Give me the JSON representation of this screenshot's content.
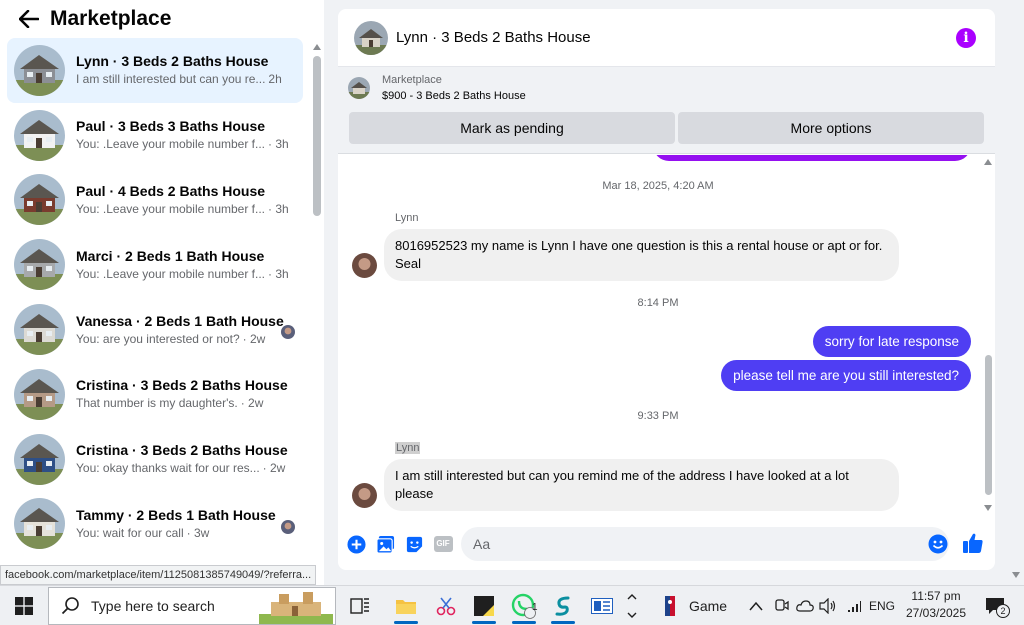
{
  "header": {
    "title": "Marketplace"
  },
  "conversations": [
    {
      "title": "Lynn · 3 Beds 2 Baths House",
      "snippet": "I am still interested but can you re...",
      "time": "2h",
      "active": true,
      "read_avatar": false,
      "house_color": "#8c8f95"
    },
    {
      "title": "Paul · 3 Beds 3 Baths House",
      "snippet": "You: .Leave your mobile number f...",
      "time": "· 3h",
      "active": false,
      "read_avatar": false,
      "house_color": "#f2f2f2"
    },
    {
      "title": "Paul · 4 Beds 2 Baths House",
      "snippet": "You: .Leave your mobile number f...",
      "time": "· 3h",
      "active": false,
      "read_avatar": false,
      "house_color": "#7a3b2e"
    },
    {
      "title": "Marci · 2 Beds 1 Bath House",
      "snippet": "You: .Leave your mobile number f...",
      "time": "· 3h",
      "active": false,
      "read_avatar": false,
      "house_color": "#a7a9ab"
    },
    {
      "title": "Vanessa · 2 Beds 1 Bath House",
      "snippet": "You: are you interested or not?",
      "time": "· 2w",
      "active": false,
      "read_avatar": true,
      "house_color": "#dcdad4"
    },
    {
      "title": "Cristina · 3 Beds 2 Baths House",
      "snippet": "That number is my daughter's.",
      "time": "· 2w",
      "active": false,
      "read_avatar": false,
      "house_color": "#b59a86"
    },
    {
      "title": "Cristina · 3 Beds 2 Baths House",
      "snippet": "You: okay thanks wait for our res...",
      "time": "· 2w",
      "active": false,
      "read_avatar": false,
      "house_color": "#2e4f86"
    },
    {
      "title": "Tammy · 2 Beds 1 Bath House",
      "snippet": "You: wait for our call",
      "time": "· 3w",
      "active": false,
      "read_avatar": true,
      "house_color": "#e5e2da"
    }
  ],
  "status_bar": {
    "url": "facebook.com/marketplace/item/1125081385749049/?referra..."
  },
  "chat": {
    "title": "Lynn · 3 Beds 2 Baths House",
    "info_icon": "info-icon",
    "listing": {
      "label": "Marketplace",
      "title": "$900 - 3 Beds 2 Baths House"
    },
    "buttons": {
      "pending": "Mark as pending",
      "more": "More options"
    },
    "messages": {
      "stamp1": "Mar 18, 2025, 4:20 AM",
      "sender1": "Lynn",
      "msg1": "8016952523 my name is Lynn I  have one question is this a rental house or apt or for. Seal",
      "stamp2": "8:14 PM",
      "out1": "sorry for late response",
      "out2": "please tell me are you still interested?",
      "stamp3": "9:33 PM",
      "sender2": "Lynn",
      "msg2": "I am still interested but can you remind me of the address I have looked at a lot please"
    },
    "composer": {
      "placeholder": "Aa",
      "gif_label": "GIF"
    },
    "colors": {
      "outgoing": "#4f3ef3",
      "accent": "#0866ff",
      "partial": "#9510f0"
    }
  },
  "taskbar": {
    "search_placeholder": "Type here to search",
    "whatsapp_badge": "1",
    "game_label": "Game",
    "language": "ENG",
    "time": "11:57 pm",
    "date": "27/03/2025",
    "notification_badge": "2"
  }
}
